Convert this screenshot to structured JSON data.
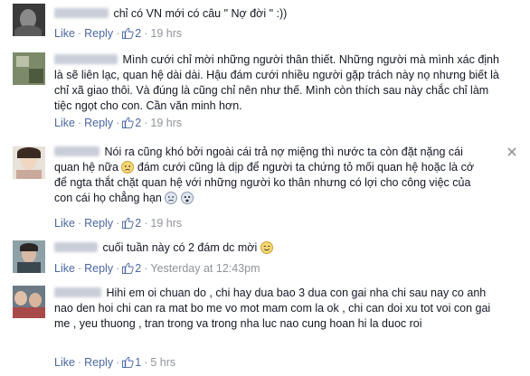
{
  "comments": [
    {
      "text": "chỉ có VN mới có câu \" Nợ đời \" :))",
      "like": "Like",
      "reply": "Reply",
      "likes": "2",
      "time": "19 hrs"
    },
    {
      "text": "Mình cưới chỉ mời những người thân thiết. Những người mà mình xác định là sẽ liên lạc, quan hệ dài dài. Hậu đám cưới nhiều người gặp trách này nọ nhưng biết là chỉ xã giao thôi. Và đúng là cũng chỉ nên như thế. Mình còn thích sau này chắc chỉ làm tiệc ngọt cho con. Cần văn minh hơn.",
      "like": "Like",
      "reply": "Reply",
      "likes": "2",
      "time": "19 hrs"
    },
    {
      "text_a": "Nói ra cũng khó bởi ngoài cái trả nợ miệng thì nước ta còn đặt nặng cái quan hệ nữa",
      "text_b": "đám cưới cũng là dịp để người ta chứng tỏ mối quan hệ hoặc là cớ để ngta thắt chặt quan hệ với những người ko thân nhưng có lợi cho công việc của con cái họ chẳng hạn",
      "like": "Like",
      "reply": "Reply",
      "likes": "2",
      "time": "19 hrs"
    },
    {
      "text": "cuối tuần này có 2 đám dc mời",
      "like": "Like",
      "reply": "Reply",
      "likes": "2",
      "time": "Yesterday at 12:43pm"
    },
    {
      "text": "Hihi em oi chuan do , chi hay dua bao 3 dua con gai nha chi sau nay co anh nao den hoi chi can ra mat bo me vo mot mam com la ok , chi can doi xu tot voi con gai me , yeu thuong , tran trong va trong nha luc nao cung hoan hi la duoc roi",
      "like": "Like",
      "reply": "Reply",
      "likes": "1",
      "time": "5 hrs"
    }
  ],
  "colors": {
    "link": "#4b67a1",
    "meta": "#90949c",
    "text": "#141823"
  },
  "icons": [
    "thumbs-up-icon",
    "sad-face-icon",
    "smile-face-icon",
    "close-icon"
  ]
}
